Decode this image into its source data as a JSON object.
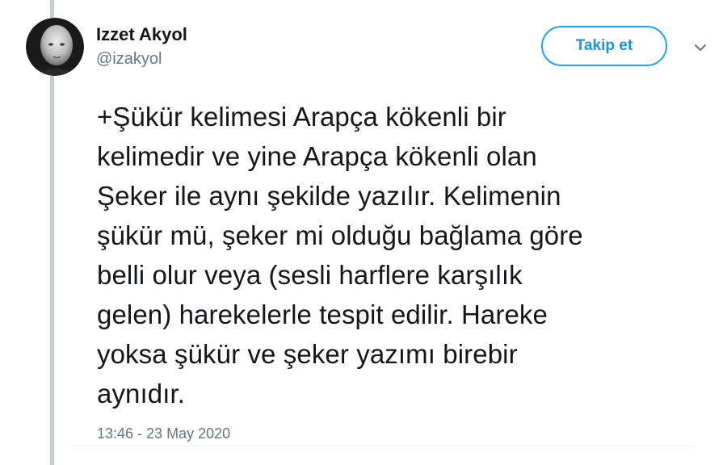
{
  "tweet": {
    "author_name": "Izzet Akyol",
    "author_handle": "@izakyol",
    "follow_label": "Takip et",
    "text": "+Şükür kelimesi Arapça kökenli bir\nkelimedir ve yine Arapça kökenli olan\nŞeker ile aynı şekilde yazılır. Kelimenin\nşükür mü, şeker mi olduğu bağlama göre\nbelli olur veya (sesli harflere karşılık\ngelen) harekelerle tespit edilir. Hareke\nyoksa şükür ve şeker yazımı birebir\naynıdır.",
    "timestamp": "13:46 - 23 May 2020"
  },
  "icons": {
    "more": "chevron-down-icon"
  },
  "colors": {
    "accent": "#1da1f2",
    "text": "#14171a",
    "secondary": "#657786",
    "thread_line": "#c4cfd6"
  }
}
